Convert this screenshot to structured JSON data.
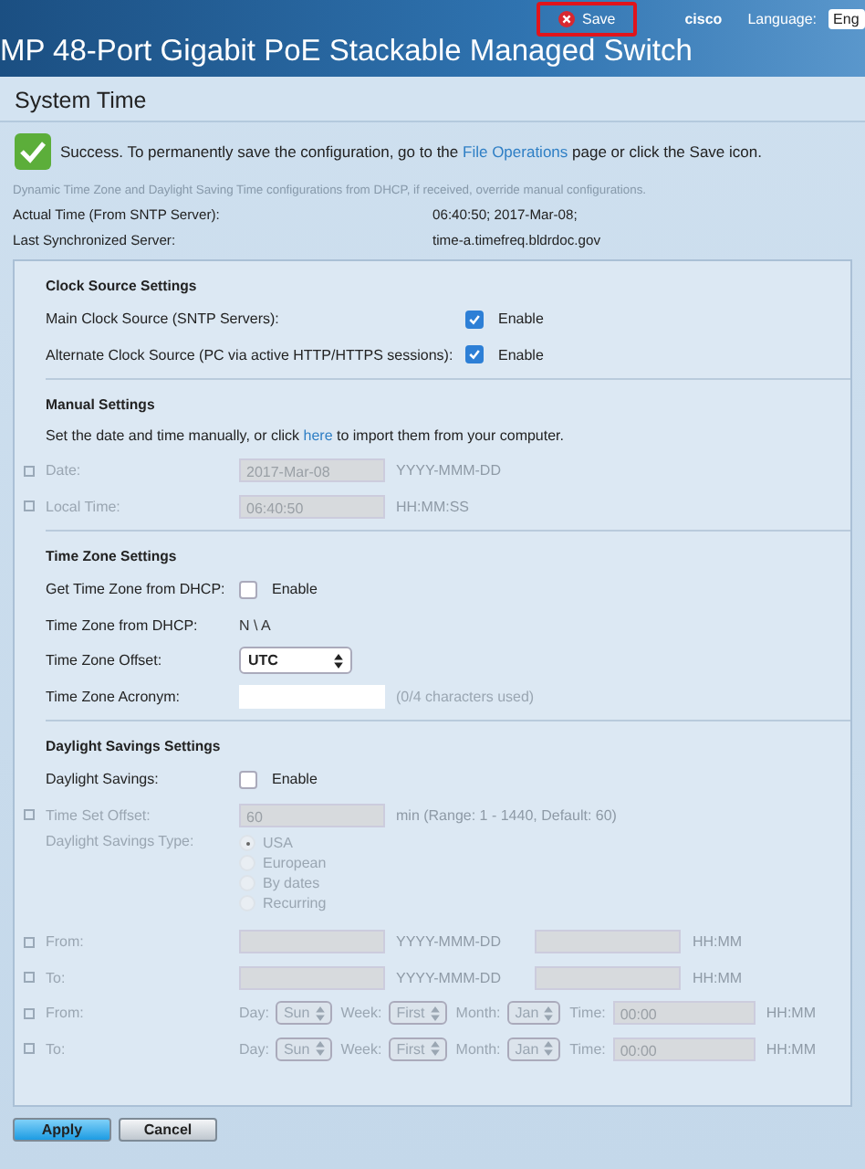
{
  "header": {
    "title": "MP 48-Port Gigabit PoE Stackable Managed Switch",
    "save_label": "Save",
    "save_highlighted": true,
    "brand": "cisco",
    "language_label": "Language:",
    "language_value": "Eng"
  },
  "page_title": "System Time",
  "success": {
    "before": "Success. To permanently save the configuration, go to the ",
    "link": "File Operations",
    "after": " page or click the Save icon."
  },
  "note": "Dynamic Time Zone and Daylight Saving Time configurations from DHCP, if received, override manual configurations.",
  "info": [
    {
      "label": "Actual Time (From SNTP Server):",
      "value": "06:40:50; 2017-Mar-08;"
    },
    {
      "label": "Last Synchronized Server:",
      "value": "time-a.timefreq.bldrdoc.gov"
    }
  ],
  "sections": [
    {
      "title": "Clock Source Settings",
      "rows": [
        {
          "kind": "checkbox",
          "label": "Main Clock Source (SNTP Servers):",
          "checked": true,
          "option": "Enable",
          "wide": true
        },
        {
          "kind": "checkbox",
          "label": "Alternate Clock Source (PC via active HTTP/HTTPS sessions):",
          "checked": true,
          "option": "Enable",
          "wide": true
        }
      ]
    },
    {
      "title": "Manual Settings",
      "rows": [
        {
          "kind": "intro",
          "before": "Set the date and time manually, or click ",
          "link": "here",
          "after": " to import them from your computer."
        },
        {
          "kind": "field",
          "label": "Date:",
          "required": true,
          "disabled": true,
          "value": "2017-Mar-08",
          "hint": "YYYY-MMM-DD"
        },
        {
          "kind": "field",
          "label": "Local Time:",
          "required": true,
          "disabled": true,
          "value": "06:40:50",
          "hint": "HH:MM:SS"
        }
      ]
    },
    {
      "title": "Time Zone Settings",
      "rows": [
        {
          "kind": "checkbox",
          "label": "Get Time Zone from DHCP:",
          "checked": false,
          "option": "Enable"
        },
        {
          "kind": "text",
          "label": "Time Zone from DHCP:",
          "value": "N \\ A"
        },
        {
          "kind": "select",
          "label": "Time Zone Offset:",
          "value": "UTC"
        },
        {
          "kind": "field",
          "label": "Time Zone Acronym:",
          "required": false,
          "disabled": false,
          "hint": "(0/4 characters used)"
        }
      ]
    },
    {
      "title": "Daylight Savings Settings",
      "rows": [
        {
          "kind": "checkbox",
          "label": "Daylight Savings:",
          "checked": false,
          "option": "Enable"
        },
        {
          "kind": "field",
          "label": "Time Set Offset:",
          "required": true,
          "disabled": true,
          "value": "60",
          "hint": "min (Range: 1 - 1440, Default: 60)"
        },
        {
          "kind": "radio",
          "label": "Daylight Savings Type:",
          "disabled": true,
          "options": [
            {
              "label": "USA",
              "selected": true
            },
            {
              "label": "European",
              "selected": false
            },
            {
              "label": "By dates",
              "selected": false
            },
            {
              "label": "Recurring",
              "selected": false
            }
          ]
        },
        {
          "kind": "dates",
          "label": "From:",
          "required": true,
          "disabled": true,
          "fields": [
            {
              "hint": "YYYY-MMM-DD"
            },
            {
              "hint": "HH:MM"
            }
          ]
        },
        {
          "kind": "dates",
          "label": "To:",
          "required": true,
          "disabled": true,
          "fields": [
            {
              "hint": "YYYY-MMM-DD"
            },
            {
              "hint": "HH:MM"
            }
          ]
        },
        {
          "kind": "recurring",
          "label": "From:",
          "required": true,
          "disabled": true,
          "parts": [
            {
              "kind": "select",
              "label": "Day:",
              "value": "Sun"
            },
            {
              "kind": "select",
              "label": "Week:",
              "value": "First"
            },
            {
              "kind": "select",
              "label": "Month:",
              "value": "Jan"
            },
            {
              "kind": "field",
              "label": "Time:",
              "value": "00:00"
            }
          ],
          "hint": "HH:MM"
        },
        {
          "kind": "recurring",
          "label": "To:",
          "required": true,
          "disabled": true,
          "parts": [
            {
              "kind": "select",
              "label": "Day:",
              "value": "Sun"
            },
            {
              "kind": "select",
              "label": "Week:",
              "value": "First"
            },
            {
              "kind": "select",
              "label": "Month:",
              "value": "Jan"
            },
            {
              "kind": "field",
              "label": "Time:",
              "value": "00:00"
            }
          ],
          "hint": "HH:MM"
        }
      ]
    }
  ],
  "buttons": [
    {
      "label": "Apply",
      "primary": true
    },
    {
      "label": "Cancel",
      "primary": false
    }
  ]
}
